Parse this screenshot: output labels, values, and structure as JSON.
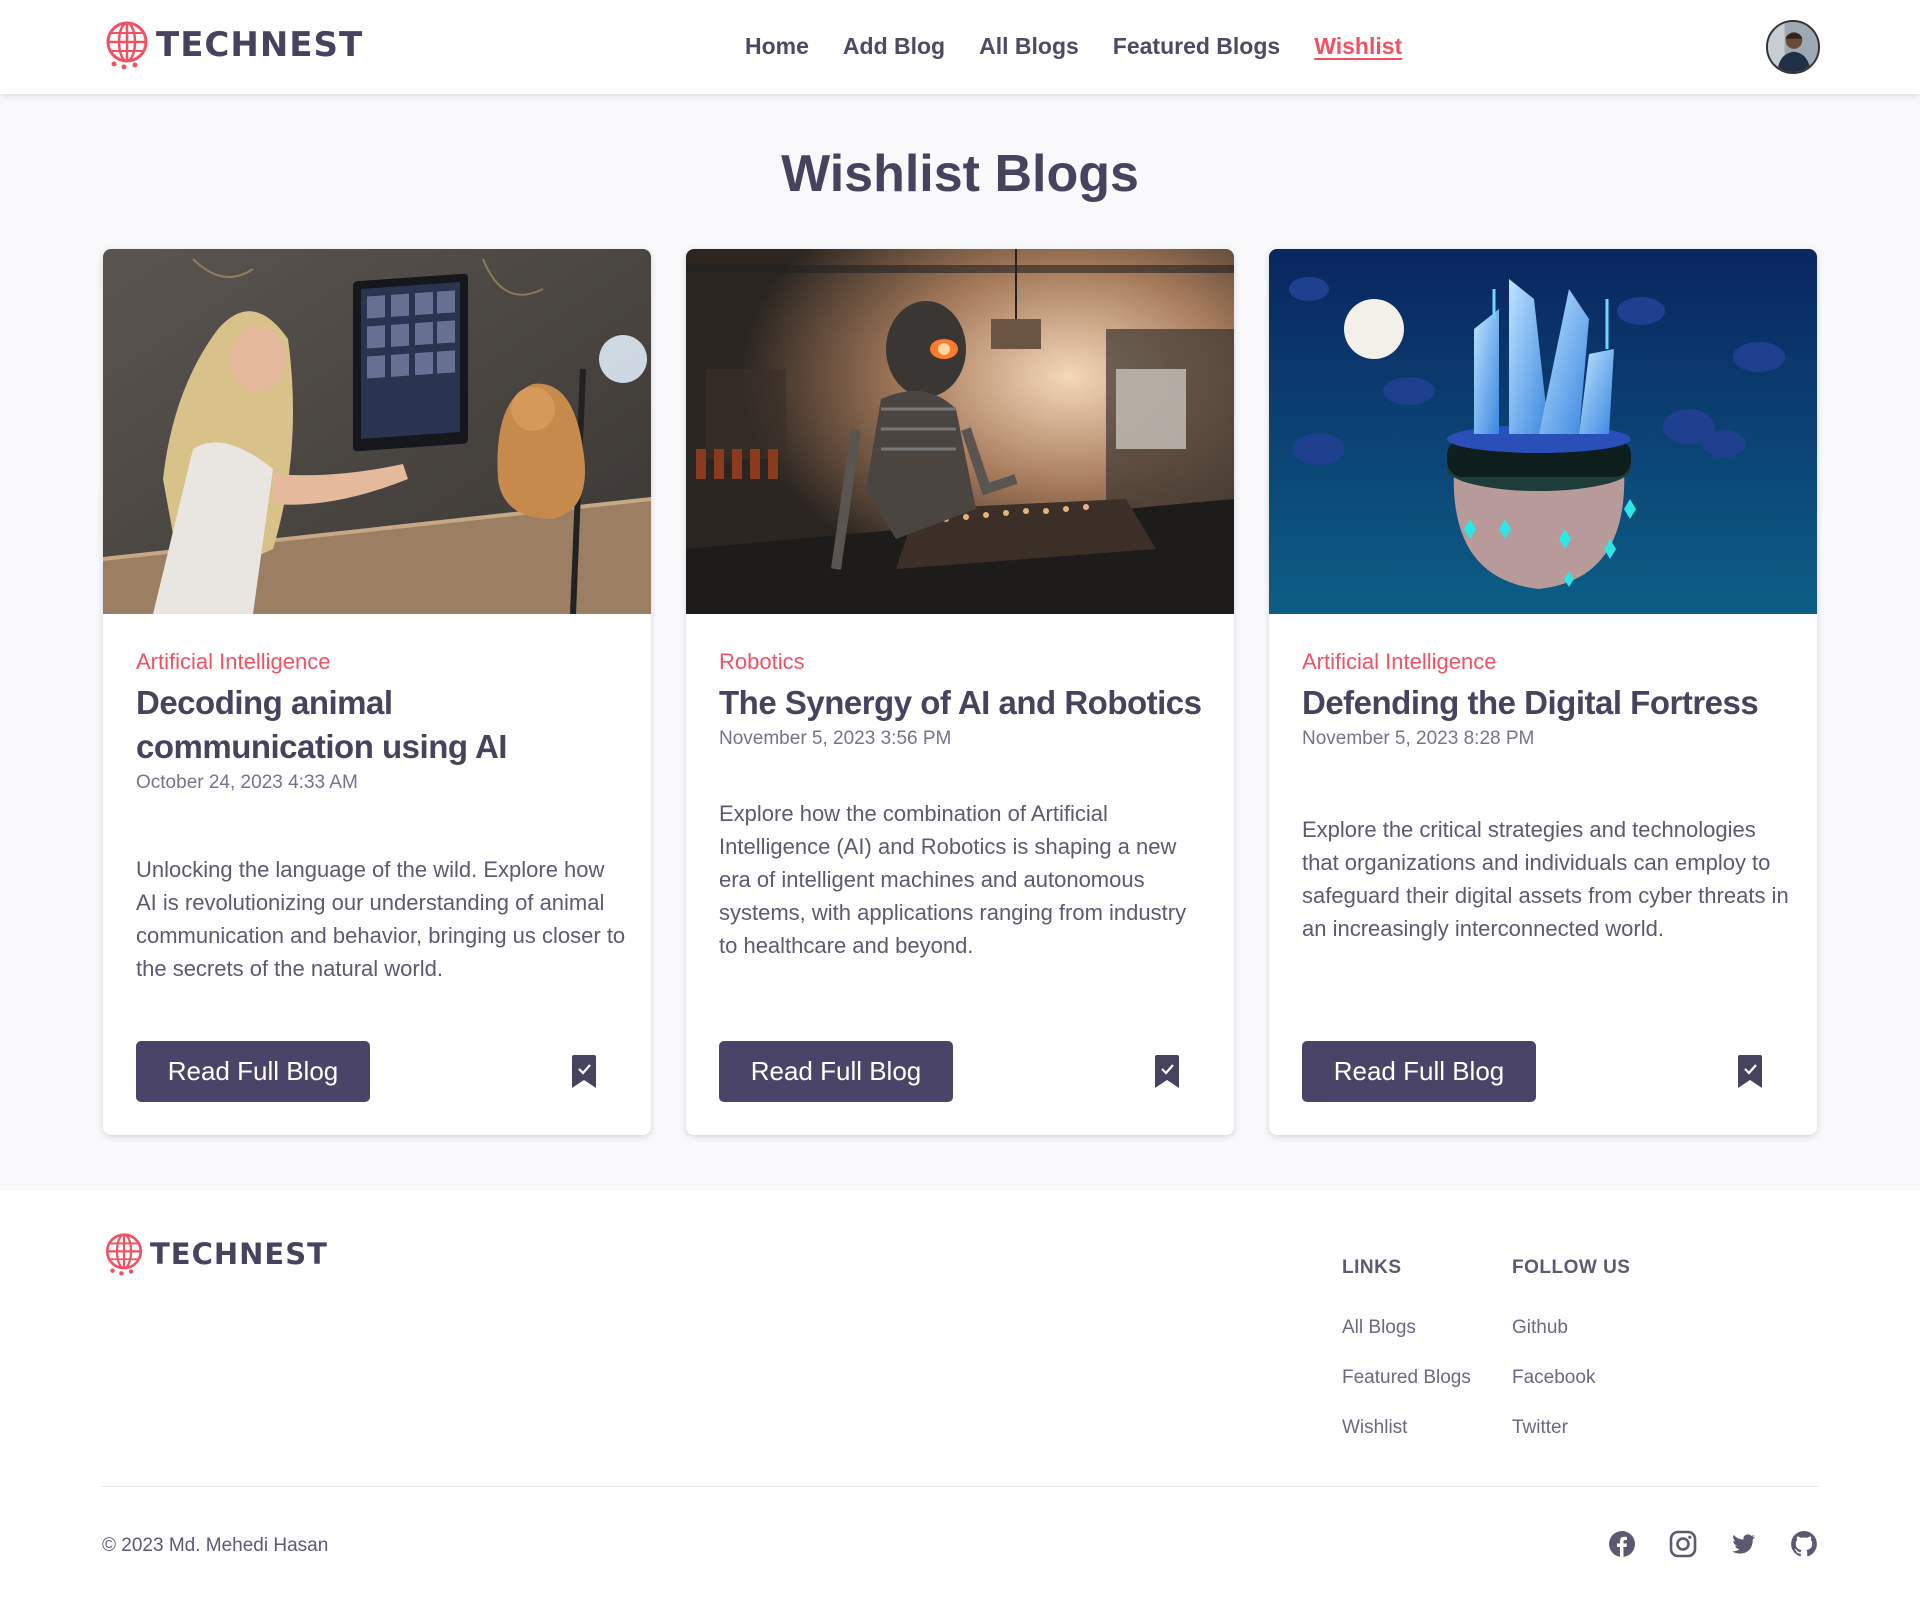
{
  "brand": {
    "name": "TECHNEST",
    "accent": "#f05262",
    "primary": "#4a4568"
  },
  "nav": {
    "links": [
      {
        "label": "Home"
      },
      {
        "label": "Add Blog"
      },
      {
        "label": "All Blogs"
      },
      {
        "label": "Featured Blogs"
      },
      {
        "label": "Wishlist",
        "active": true
      }
    ],
    "avatar_icon": "user-avatar"
  },
  "page": {
    "title": "Wishlist Blogs"
  },
  "cards": [
    {
      "category": "Artificial Intelligence",
      "title": "Decoding animal communication using AI",
      "date": "October 24, 2023 4:33 AM",
      "excerpt": "Unlocking the language of the wild. Explore how AI is revolutionizing our understanding of animal communication and behavior, bringing us closer to the secrets of the natural world.",
      "button": "Read Full Blog",
      "bookmark_icon": "bookmark-check-icon"
    },
    {
      "category": "Robotics",
      "title": "The Synergy of AI and Robotics",
      "date": "November 5, 2023 3:56 PM",
      "excerpt": "Explore how the combination of Artificial Intelligence (AI) and Robotics is shaping a new era of intelligent machines and autonomous systems, with applications ranging from industry to healthcare and beyond.",
      "button": "Read Full Blog",
      "bookmark_icon": "bookmark-check-icon"
    },
    {
      "category": "Artificial Intelligence",
      "title": "Defending the Digital Fortress",
      "date": "November 5, 2023 8:28 PM",
      "excerpt": "Explore the critical strategies and technologies that organizations and individuals can employ to safeguard their digital assets from cyber threats in an increasingly interconnected world.",
      "button": "Read Full Blog",
      "bookmark_icon": "bookmark-check-icon"
    }
  ],
  "footer": {
    "links_heading": "LINKS",
    "links": [
      "All Blogs",
      "Featured Blogs",
      "Wishlist"
    ],
    "follow_heading": "FOLLOW US",
    "follow": [
      "Github",
      "Facebook",
      "Twitter"
    ],
    "copyright": "© 2023 Md. Mehedi Hasan",
    "social_icons": [
      "facebook-icon",
      "instagram-icon",
      "twitter-icon",
      "github-icon"
    ]
  }
}
